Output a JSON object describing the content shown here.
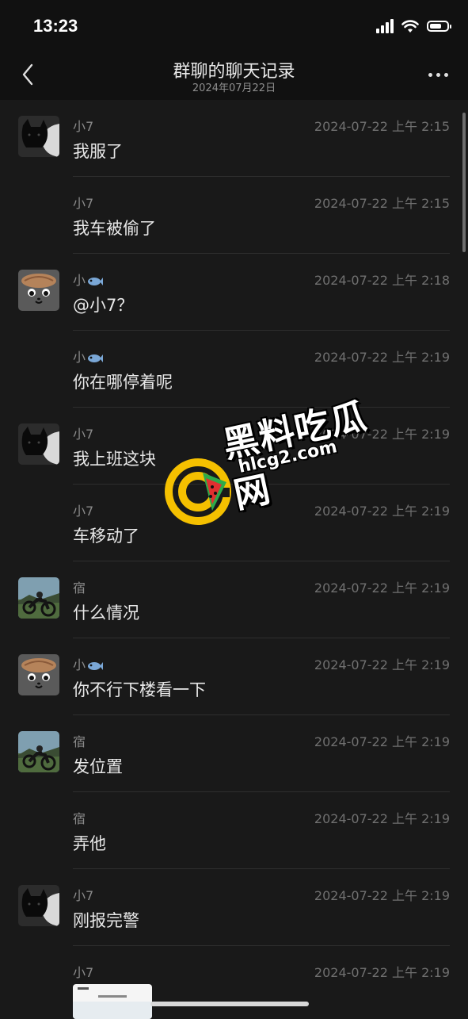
{
  "status_bar": {
    "time": "13:23",
    "battery_level": 0.7
  },
  "header": {
    "title": "群聊的聊天记录",
    "subtitle": "2024年07月22日"
  },
  "messages": [
    {
      "sender": "小7",
      "timestamp": "2024-07-22 上午 2:15",
      "text": "我服了",
      "avatar": "cat-avatar",
      "show_avatar": true
    },
    {
      "sender": "小7",
      "timestamp": "2024-07-22 上午 2:15",
      "text": "我车被偷了",
      "avatar": "cat-avatar",
      "show_avatar": false
    },
    {
      "sender": "小",
      "sender_emoji": "fish",
      "timestamp": "2024-07-22 上午 2:18",
      "text": "@小7？",
      "avatar": "cartoon-face-avatar",
      "show_avatar": true
    },
    {
      "sender": "小",
      "sender_emoji": "fish",
      "timestamp": "2024-07-22 上午 2:19",
      "text": "你在哪停着呢",
      "avatar": "cartoon-face-avatar",
      "show_avatar": false
    },
    {
      "sender": "小7",
      "timestamp": "2024-07-22 上午 2:19",
      "text": "我上班这块",
      "avatar": "cat-avatar",
      "show_avatar": true
    },
    {
      "sender": "小7",
      "timestamp": "2024-07-22 上午 2:19",
      "text": "车移动了",
      "avatar": "cat-avatar",
      "show_avatar": false
    },
    {
      "sender": "宿",
      "timestamp": "2024-07-22 上午 2:19",
      "text": "什么情况",
      "avatar": "motorcycle-avatar",
      "show_avatar": true
    },
    {
      "sender": "小",
      "sender_emoji": "fish",
      "timestamp": "2024-07-22 上午 2:19",
      "text": "你不行下楼看一下",
      "avatar": "cartoon-face-avatar",
      "show_avatar": true
    },
    {
      "sender": "宿",
      "timestamp": "2024-07-22 上午 2:19",
      "text": "发位置",
      "avatar": "motorcycle-avatar",
      "show_avatar": true
    },
    {
      "sender": "宿",
      "timestamp": "2024-07-22 上午 2:19",
      "text": "弄他",
      "avatar": "motorcycle-avatar",
      "show_avatar": false
    },
    {
      "sender": "小7",
      "timestamp": "2024-07-22 上午 2:19",
      "text": "刚报完警",
      "avatar": "cat-avatar",
      "show_avatar": true
    },
    {
      "sender": "小7",
      "timestamp": "2024-07-22 上午 2:19",
      "text": "",
      "avatar": "cat-avatar",
      "show_avatar": false,
      "attachment": "screenshot-image"
    }
  ],
  "watermark": {
    "title": "黑料吃瓜网",
    "url": "hlcg2.com"
  },
  "colors": {
    "background": "#191919",
    "header": "#111111",
    "logo_yellow": "#F5C000",
    "logo_red": "#E03030",
    "logo_green": "#2EAA4A"
  }
}
